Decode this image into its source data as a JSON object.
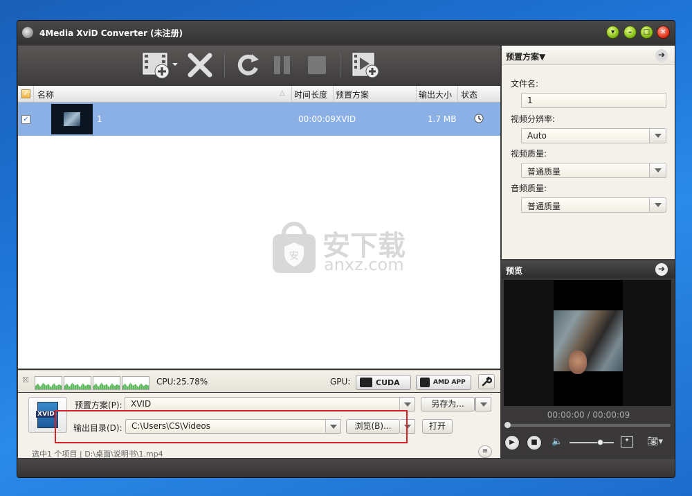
{
  "window": {
    "title": "4Media XviD Converter (未注册)"
  },
  "list": {
    "headers": {
      "name": "名称",
      "duration": "时间长度",
      "profile": "预置方案",
      "size": "输出大小",
      "status": "状态"
    },
    "rows": [
      {
        "name": "1",
        "duration": "00:00:09",
        "profile": "XVID",
        "size": "1.7 MB"
      }
    ]
  },
  "watermark": {
    "brand": "安下载",
    "domain": "anxz.com"
  },
  "cpu": {
    "label": "CPU:25.78%",
    "gpu_label": "GPU:",
    "cuda": "CUDA",
    "amd": "AMD APP"
  },
  "bottom": {
    "format_badge": "XVID",
    "profile_label": "预置方案(P):",
    "profile_value": "XVID",
    "saveas": "另存为...",
    "output_label": "输出目录(D):",
    "output_value": "C:\\Users\\CS\\Videos",
    "browse": "浏览(B)...",
    "open": "打开",
    "status": "选中1 个项目 | D:\\桌面\\说明书\\1.mp4"
  },
  "preset_panel": {
    "title": "预置方案▼",
    "filename_label": "文件名:",
    "filename_value": "1",
    "resolution_label": "视频分辨率:",
    "resolution_value": "Auto",
    "vquality_label": "视频质量:",
    "vquality_value": "普通质量",
    "aquality_label": "音频质量:",
    "aquality_value": "普通质量"
  },
  "preview": {
    "title": "预览",
    "time": "00:00:00 / 00:00:09"
  },
  "colors": {
    "accent_row": "#8ab0e6",
    "highlight": "#d8202a"
  }
}
